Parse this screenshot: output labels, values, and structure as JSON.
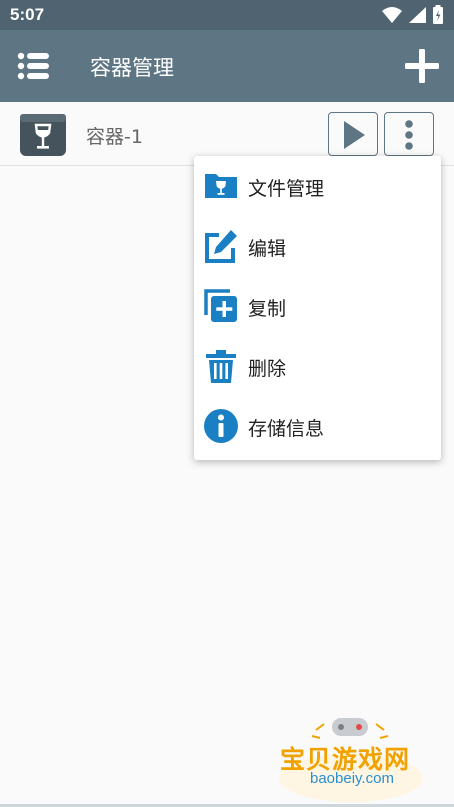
{
  "status_bar": {
    "time": "5:07",
    "icons": [
      "wifi-icon",
      "signal-icon",
      "battery-icon"
    ]
  },
  "app_bar": {
    "title": "容器管理",
    "menu_icon": "list-menu-icon",
    "add_icon": "plus-icon"
  },
  "containers": [
    {
      "name": "容器-1",
      "icon": "wine-container-icon"
    }
  ],
  "context_menu": {
    "items": [
      {
        "label": "文件管理",
        "icon": "folder-icon"
      },
      {
        "label": "编辑",
        "icon": "edit-icon"
      },
      {
        "label": "复制",
        "icon": "duplicate-icon"
      },
      {
        "label": "删除",
        "icon": "trash-icon"
      },
      {
        "label": "存储信息",
        "icon": "info-icon"
      }
    ]
  },
  "watermark": {
    "title": "宝贝游戏网",
    "url": "baobeiy.com"
  },
  "colors": {
    "status_bar": "#4f6470",
    "app_bar": "#5e7584",
    "icon_blue": "#1b7fc4",
    "background": "#fafafa"
  }
}
